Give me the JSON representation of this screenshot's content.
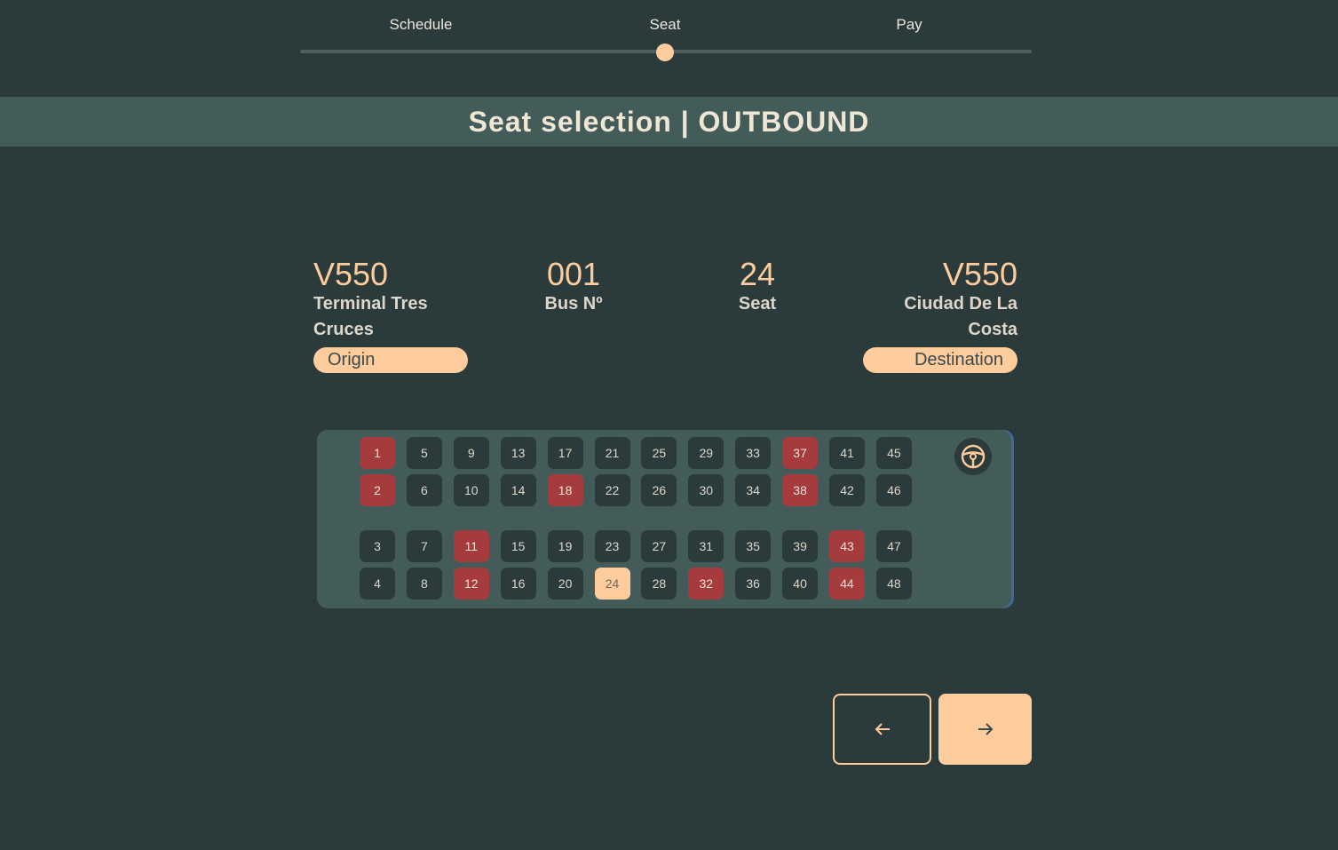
{
  "stepper": {
    "steps": [
      "Schedule",
      "Seat",
      "Pay"
    ],
    "current_step": "Seat"
  },
  "banner": {
    "title": "Seat selection | OUTBOUND"
  },
  "trip": {
    "origin": {
      "code": "V550",
      "name": "Terminal Tres Cruces",
      "badge": "Origin"
    },
    "bus": {
      "number": "001",
      "label": "Bus Nº"
    },
    "seat": {
      "number": "24",
      "label": "Seat"
    },
    "destination": {
      "code": "V550",
      "name": "Ciudad De La Costa",
      "badge": "Destination"
    }
  },
  "seat_map": {
    "rows": [
      [
        1,
        5,
        9,
        13,
        17,
        21,
        25,
        29,
        33,
        37,
        41,
        45
      ],
      [
        2,
        6,
        10,
        14,
        18,
        22,
        26,
        30,
        34,
        38,
        42,
        46
      ],
      [
        3,
        7,
        11,
        15,
        19,
        23,
        27,
        31,
        35,
        39,
        43,
        47
      ],
      [
        4,
        8,
        12,
        16,
        20,
        24,
        28,
        32,
        36,
        40,
        44,
        48
      ]
    ],
    "taken": [
      1,
      2,
      11,
      12,
      18,
      32,
      37,
      38,
      43,
      44
    ],
    "selected": 24,
    "driver_icon": "steering-wheel-icon"
  },
  "colors": {
    "background": "#2b3a3b",
    "panel": "#445c59",
    "accent": "#ffcc9d",
    "taken": "#a63b3d"
  },
  "nav": {
    "back_icon": "arrow-left-icon",
    "next_icon": "arrow-right-icon"
  }
}
